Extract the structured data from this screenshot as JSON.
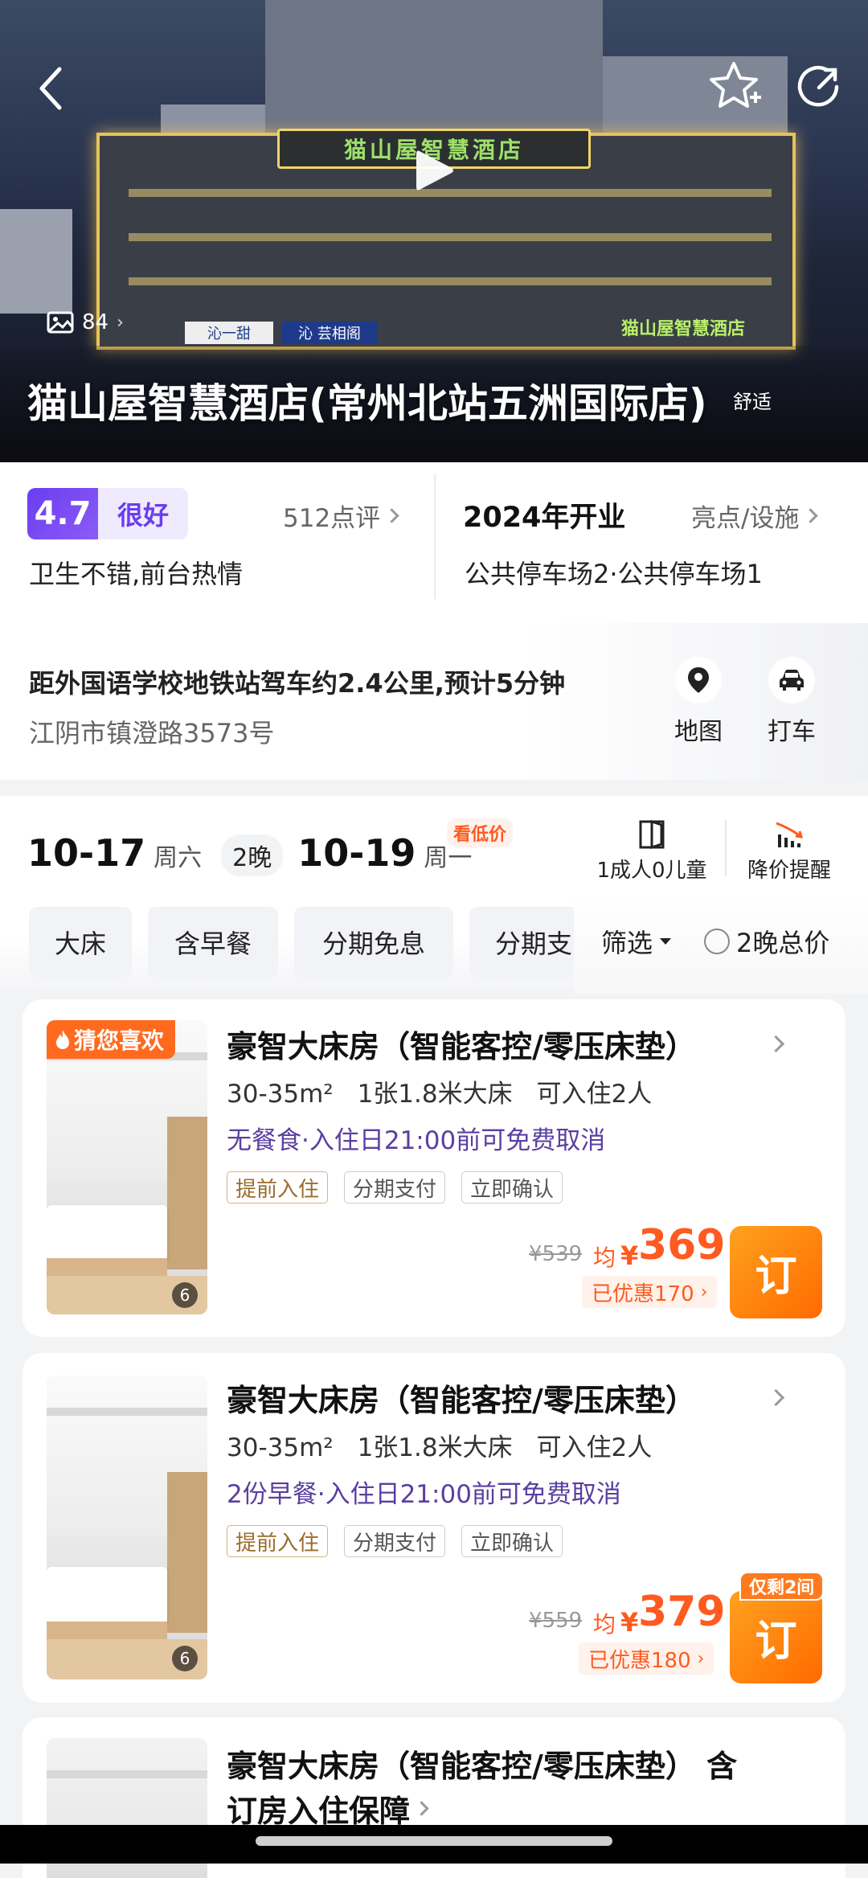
{
  "hero": {
    "photo_count": "84",
    "hotel_name": "猫山屋智慧酒店(常州北站五洲国际店)",
    "hotel_tag": "舒适",
    "sign_top": "猫山屋智慧酒店",
    "sign_bottom": "猫山屋智慧酒店",
    "shop_a": "沁一甜",
    "shop_b": "沁 芸相阁"
  },
  "rating": {
    "score": "4.7",
    "label": "很好",
    "reviews": "512点评",
    "summary": "卫生不错,前台热情"
  },
  "facility": {
    "opened": "2024年开业",
    "link": "亮点/设施",
    "summary": "公共停车场2·公共停车场1"
  },
  "location": {
    "distance": "距外国语学校地铁站驾车约2.4公里,预计5分钟",
    "address": "江阴市镇澄路3573号",
    "map_label": "地图",
    "taxi_label": "打车"
  },
  "dates": {
    "checkin": "10-17",
    "checkin_day": "周六",
    "nights": "2晚",
    "checkout": "10-19",
    "checkout_day": "周一",
    "low_price_badge": "看低价",
    "guests": "1成人0儿童",
    "price_alert": "降价提醒"
  },
  "filters": {
    "chips": [
      "大床",
      "含早餐",
      "分期免息",
      "分期支"
    ],
    "filter_label": "筛选",
    "total_label": "2晚总价"
  },
  "rooms": [
    {
      "badge": "猜您喜欢",
      "photos": "6",
      "title": "豪智大床房（智能客控/零压床垫）",
      "size": "30-35m²",
      "bed": "1张1.8米大床",
      "guests": "可入住2人",
      "policy": "无餐食·入住日21:00前可免费取消",
      "tags": [
        "提前入住",
        "分期支付",
        "立即确认"
      ],
      "old_price": "¥539",
      "avg": "均",
      "currency": "¥",
      "price": "369",
      "discount": "已优惠170",
      "book": "订"
    },
    {
      "photos": "6",
      "title": "豪智大床房（智能客控/零压床垫）",
      "size": "30-35m²",
      "bed": "1张1.8米大床",
      "guests": "可入住2人",
      "policy": "2份早餐·入住日21:00前可免费取消",
      "tags": [
        "提前入住",
        "分期支付",
        "立即确认"
      ],
      "old_price": "¥559",
      "avg": "均",
      "currency": "¥",
      "price": "379",
      "discount": "已优惠180",
      "book": "订",
      "remaining": "仅剩2间"
    },
    {
      "title": "豪智大床房（智能客控/零压床垫） 含",
      "subtitle": "订房入住保障"
    }
  ]
}
